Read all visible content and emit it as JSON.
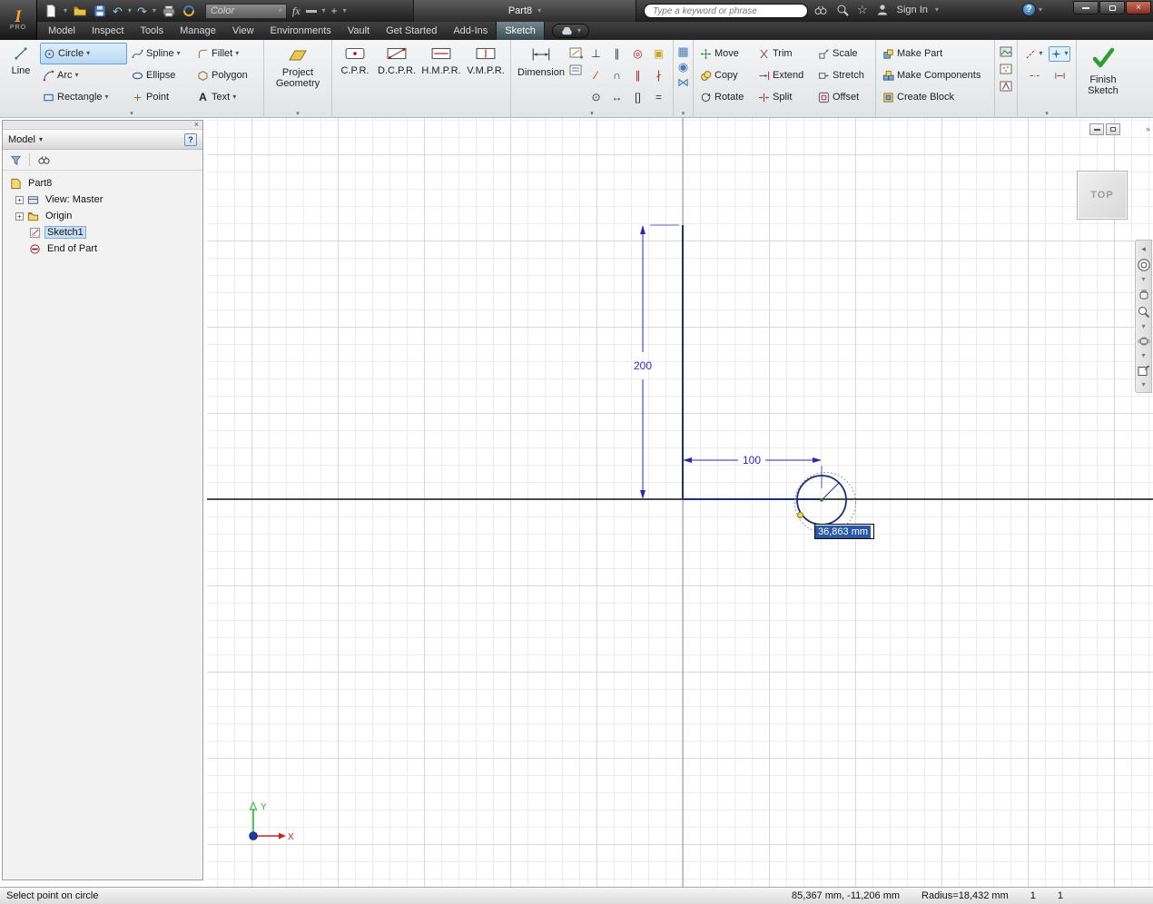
{
  "titlebar": {
    "color_label": "Color",
    "doc_title": "Part8",
    "search_placeholder": "Type a keyword or phrase",
    "sign_in": "Sign In"
  },
  "tabs": {
    "items": [
      "Model",
      "Inspect",
      "Tools",
      "Manage",
      "View",
      "Environments",
      "Vault",
      "Get Started",
      "Add-Ins",
      "Sketch"
    ]
  },
  "ribbon": {
    "line": "Line",
    "circle": "Circle",
    "arc": "Arc",
    "rectangle": "Rectangle",
    "spline": "Spline",
    "ellipse": "Ellipse",
    "point": "Point",
    "fillet": "Fillet",
    "polygon": "Polygon",
    "text_label": "Text",
    "project_geometry": "Project Geometry",
    "cpr": "C.P.R.",
    "dcpr": "D.C.P.R.",
    "hmpr": "H.M.P.R.",
    "vmpr": "V.M.P.R.",
    "dimension": "Dimension",
    "move": "Move",
    "copy": "Copy",
    "rotate": "Rotate",
    "trim": "Trim",
    "extend": "Extend",
    "split": "Split",
    "scale": "Scale",
    "stretch": "Stretch",
    "offset": "Offset",
    "make_part": "Make Part",
    "make_components": "Make Components",
    "create_block": "Create Block",
    "finish_sketch": "Finish Sketch"
  },
  "browser": {
    "title": "Model",
    "tree": [
      {
        "label": "Part8"
      },
      {
        "label": "View: Master"
      },
      {
        "label": "Origin"
      },
      {
        "label": "Sketch1"
      },
      {
        "label": "End of Part"
      }
    ]
  },
  "canvas": {
    "viewcube": "TOP",
    "dim_vertical": "200",
    "dim_horizontal": "100",
    "radius_tooltip": "36,863 mm",
    "axis_x": "X",
    "axis_y": "Y"
  },
  "statusbar": {
    "message": "Select point on circle",
    "coordinates": "85,367 mm, -11,206 mm",
    "radius": "Radius=18,432 mm",
    "count1": "1",
    "count2": "1"
  },
  "icons": {
    "dropdown": "▾",
    "overflow": "»",
    "close": "×",
    "dock_close": "×",
    "star": "☆",
    "undo": "↶",
    "redo": "↷",
    "help": "?",
    "fx": "fx",
    "plus": "+",
    "text_tool": "A",
    "point_tool": "+",
    "collapse": "◂",
    "rect_pattern": "▦",
    "circ_pattern": "◉",
    "mirror": "⋈",
    "constraints": [
      "⊥",
      "∥",
      "◎",
      "▣",
      "⁄",
      "∩",
      "∥",
      "∤",
      "⊙",
      "↔",
      "[]",
      "="
    ]
  }
}
